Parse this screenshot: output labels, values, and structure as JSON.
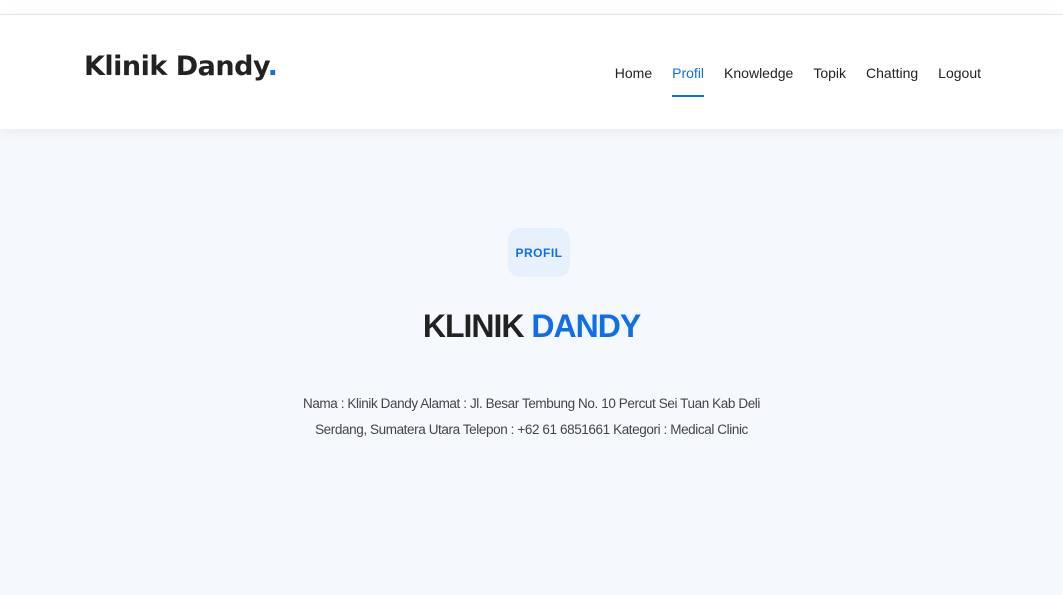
{
  "header": {
    "logo_text": "Klinik Dandy",
    "logo_dot": ".",
    "nav": {
      "items": [
        {
          "label": "Home"
        },
        {
          "label": "Profil"
        },
        {
          "label": "Knowledge"
        },
        {
          "label": "Topik"
        },
        {
          "label": "Chatting"
        },
        {
          "label": "Logout"
        }
      ],
      "active": "Profil"
    }
  },
  "section": {
    "badge": "PROFIL",
    "title_first": "KLINIK ",
    "title_accent": "DANDY",
    "description_line1": "Nama : Klinik Dandy Alamat : Jl. Besar Tembung No. 10 Percut Sei Tuan Kab Deli",
    "description_line2": "Serdang, Sumatera Utara Telepon : +62 61 6851661 Kategori : Medical Clinic"
  },
  "colors": {
    "accent": "#106eea",
    "text_dark": "#222222",
    "section_bg": "#f5f8fd",
    "badge_bg": "#e7f1fd"
  }
}
